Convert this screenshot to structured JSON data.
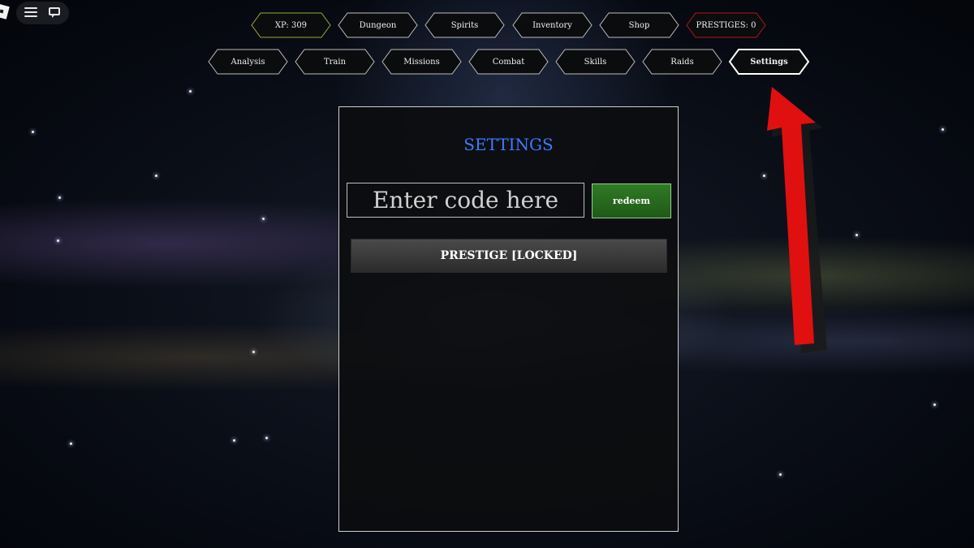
{
  "nav": {
    "row1": [
      {
        "label": "XP: 309",
        "variant": "xp"
      },
      {
        "label": "Dungeon",
        "variant": "normal"
      },
      {
        "label": "Spirits",
        "variant": "normal"
      },
      {
        "label": "Inventory",
        "variant": "normal"
      },
      {
        "label": "Shop",
        "variant": "normal"
      },
      {
        "label": "PRESTIGES: 0",
        "variant": "prestige"
      }
    ],
    "row2": [
      {
        "label": "Analysis",
        "variant": "normal"
      },
      {
        "label": "Train",
        "variant": "normal"
      },
      {
        "label": "Missions",
        "variant": "normal"
      },
      {
        "label": "Combat",
        "variant": "normal"
      },
      {
        "label": "Skills",
        "variant": "normal"
      },
      {
        "label": "Raids",
        "variant": "normal"
      },
      {
        "label": "Settings",
        "variant": "active"
      }
    ]
  },
  "settings": {
    "title": "SETTINGS",
    "code_placeholder": "Enter code here",
    "code_value": "",
    "redeem_label": "redeem",
    "prestige_label": "PRESTIGE [LOCKED]"
  },
  "colors": {
    "title_blue": "#3b7bff",
    "xp_border": "#9aa83a",
    "prestige_border": "#b01818",
    "redeem_green": "#2f7a24",
    "arrow_red": "#e01010"
  },
  "icons": {
    "roblox": "roblox-logo-icon",
    "menu": "hamburger-menu-icon",
    "chat": "chat-icon",
    "arrow": "red-arrow-icon"
  }
}
